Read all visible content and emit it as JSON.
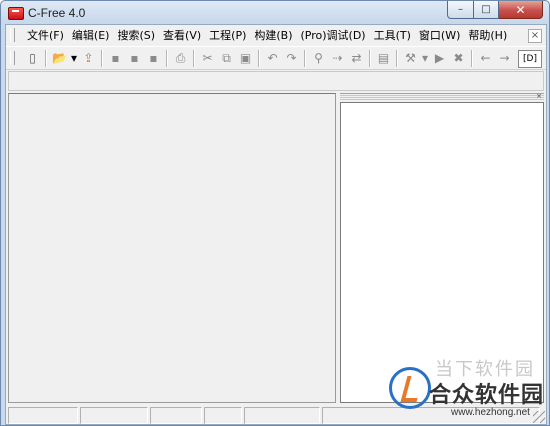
{
  "window": {
    "title": "C-Free 4.0",
    "minimize": "–",
    "maximize": "□",
    "close": "✕"
  },
  "menubar": {
    "items": [
      "文件(F)",
      "编辑(E)",
      "搜索(S)",
      "查看(V)",
      "工程(P)",
      "构建(B)",
      "(Pro)调试(D)",
      "工具(T)",
      "窗口(W)",
      "帮助(H)"
    ],
    "close_glyph": "×"
  },
  "toolbar": {
    "new": "▯",
    "open": "📂",
    "open_dropdown": "▾",
    "open_project": "⇪",
    "save": "▪",
    "save_all": "▪",
    "save_as": "▪",
    "print": "⎙",
    "cut": "✂",
    "copy": "⧉",
    "paste": "▣",
    "undo": "↶",
    "redo": "↷",
    "find": "⚲",
    "find_next": "⇢",
    "replace": "⇄",
    "bookmark": "▤",
    "build": "⚒",
    "build_dropdown": "▾",
    "run": "▶",
    "stop": "✖",
    "back": "←",
    "forward": "→",
    "right_label": "[D]"
  },
  "right_panel": {
    "close_glyph": "×"
  },
  "watermark": {
    "brand_top": "当下软件园",
    "brand_main": "合众软件园",
    "url": "www.hezhong.net"
  }
}
